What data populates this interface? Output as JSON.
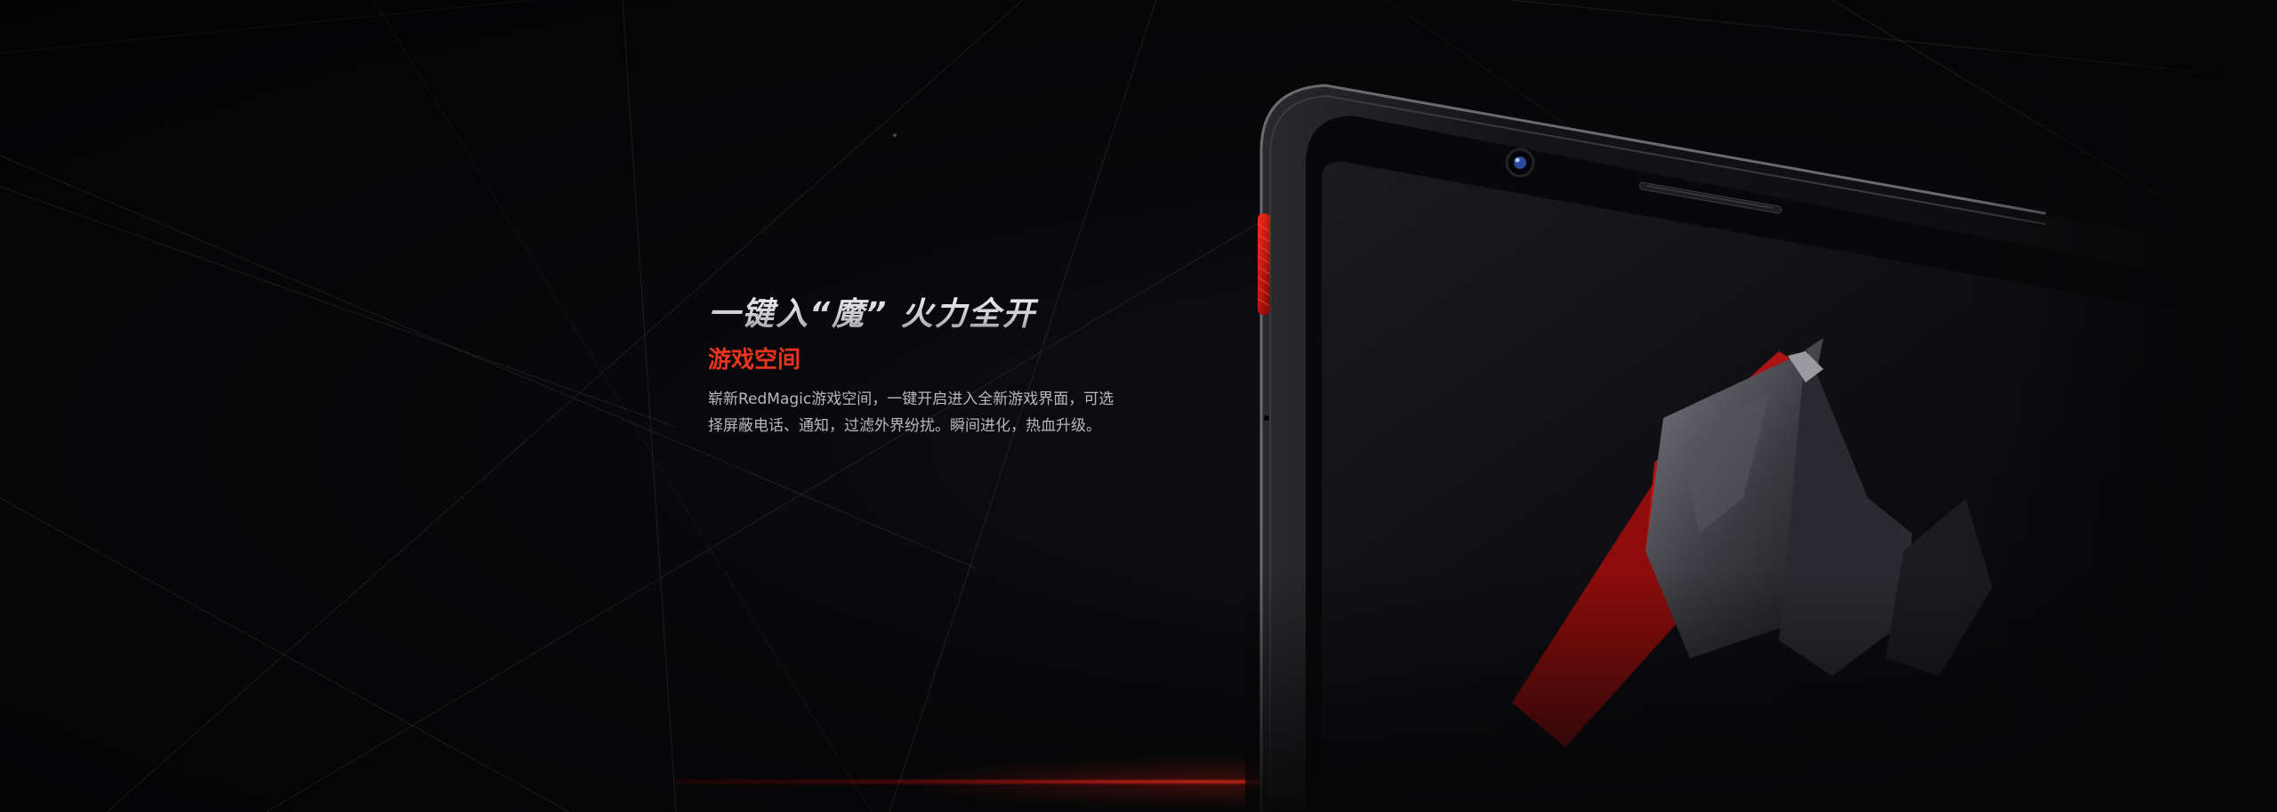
{
  "banner": {
    "headline": "一键入“魔”  火力全开",
    "subtitle": "游戏空间",
    "description": "崭新RedMagic游戏空间，一键开启进入全新游戏界面，可选择屏蔽电话、通知，过滤外界纷扰。瞬间进化，热血升级。"
  },
  "colors": {
    "background": "#050506",
    "accent_red": "#e8341c",
    "headline_silver": "#d4d4d6",
    "body_text": "#b9b9bc"
  },
  "icons": {
    "phone_illustration": "redmagic-phone-image",
    "button": "red-game-switch"
  }
}
